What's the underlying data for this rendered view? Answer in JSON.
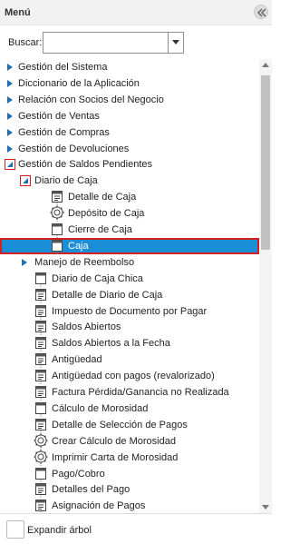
{
  "menu": {
    "title": "Menú"
  },
  "search": {
    "label": "Buscar:",
    "value": ""
  },
  "tree": [
    {
      "label": "Gestión del Sistema",
      "depth": 0,
      "kind": "folder",
      "state": "collapsed"
    },
    {
      "label": "Diccionario de la Aplicación",
      "depth": 0,
      "kind": "folder",
      "state": "collapsed"
    },
    {
      "label": "Relación con Socios del Negocio",
      "depth": 0,
      "kind": "folder",
      "state": "collapsed"
    },
    {
      "label": "Gestión de Ventas",
      "depth": 0,
      "kind": "folder",
      "state": "collapsed"
    },
    {
      "label": "Gestión de Compras",
      "depth": 0,
      "kind": "folder",
      "state": "collapsed"
    },
    {
      "label": "Gestión de Devoluciones",
      "depth": 0,
      "kind": "folder",
      "state": "collapsed"
    },
    {
      "label": "Gestión de Saldos Pendientes",
      "depth": 0,
      "kind": "folder",
      "state": "expanded"
    },
    {
      "label": "Diario de Caja",
      "depth": 1,
      "kind": "folder",
      "state": "expanded"
    },
    {
      "label": "Detalle de Caja",
      "depth": 2,
      "kind": "report"
    },
    {
      "label": "Depósito de Caja",
      "depth": 2,
      "kind": "process"
    },
    {
      "label": "Cierre de Caja",
      "depth": 2,
      "kind": "window"
    },
    {
      "label": "Caja",
      "depth": 2,
      "kind": "window",
      "selected": true
    },
    {
      "label": "Manejo de Reembolso",
      "depth": 1,
      "kind": "folder",
      "state": "collapsed"
    },
    {
      "label": "Diario de Caja Chica",
      "depth": 1,
      "kind": "window"
    },
    {
      "label": "Detalle de Diario de Caja",
      "depth": 1,
      "kind": "report"
    },
    {
      "label": "Impuesto de Documento por Pagar",
      "depth": 1,
      "kind": "report"
    },
    {
      "label": "Saldos Abiertos",
      "depth": 1,
      "kind": "report"
    },
    {
      "label": "Saldos Abiertos a la Fecha",
      "depth": 1,
      "kind": "report"
    },
    {
      "label": "Antigüedad",
      "depth": 1,
      "kind": "report"
    },
    {
      "label": "Antigüedad con pagos (revalorizado)",
      "depth": 1,
      "kind": "report"
    },
    {
      "label": "Factura Pérdida/Ganancia no Realizada",
      "depth": 1,
      "kind": "report"
    },
    {
      "label": "Cálculo de Morosidad",
      "depth": 1,
      "kind": "window"
    },
    {
      "label": "Detalle de Selección de Pagos",
      "depth": 1,
      "kind": "report"
    },
    {
      "label": "Crear Cálculo de Morosidad",
      "depth": 1,
      "kind": "process"
    },
    {
      "label": "Imprimir Carta de Morosidad",
      "depth": 1,
      "kind": "process"
    },
    {
      "label": "Pago/Cobro",
      "depth": 1,
      "kind": "window"
    },
    {
      "label": "Detalles del Pago",
      "depth": 1,
      "kind": "report"
    },
    {
      "label": "Asignación de Pagos",
      "depth": 1,
      "kind": "report"
    }
  ],
  "footer": {
    "expand_label": "Expandir árbol",
    "expand_checked": false
  },
  "colors": {
    "selection": "#1a8fd8",
    "highlight_border": "#d32020",
    "folder_arrow": "#1f6fb5"
  }
}
